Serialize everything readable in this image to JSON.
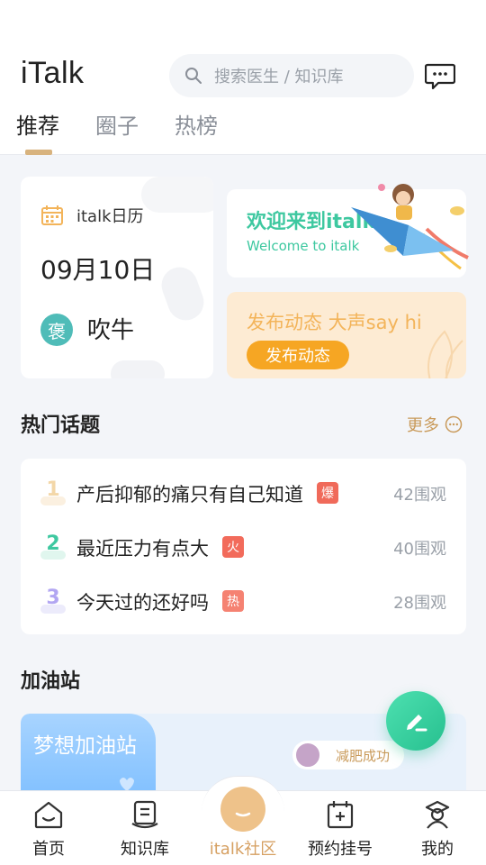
{
  "header": {
    "app_title": "iTalk",
    "search_placeholder": "搜索医生 / 知识库",
    "tabs": [
      {
        "label": "推荐",
        "active": true
      },
      {
        "label": "圈子",
        "active": false
      },
      {
        "label": "热榜",
        "active": false
      }
    ]
  },
  "calendar": {
    "title": "italk日历",
    "date": "09月10日",
    "badge": "褒",
    "note": "吹牛"
  },
  "welcome": {
    "title": "欢迎来到italk",
    "subtitle": "Welcome to italk"
  },
  "post": {
    "title": "发布动态 大声say hi",
    "button": "发布动态"
  },
  "hot_topics": {
    "title": "热门话题",
    "more": "更多",
    "items": [
      {
        "rank": "1",
        "text": "产后抑郁的痛只有自己知道",
        "tag": "爆",
        "tag_color": "#f06a5a",
        "count": "42围观",
        "rank_color": "#f3d7a8"
      },
      {
        "rank": "2",
        "text": "最近压力有点大",
        "tag": "火",
        "tag_color": "#f26b5b",
        "count": "40围观",
        "rank_color": "#3ec8a0"
      },
      {
        "rank": "3",
        "text": "今天过的还好吗",
        "tag": "热",
        "tag_color": "#f58272",
        "count": "28围观",
        "rank_color": "#b2a6f2"
      }
    ]
  },
  "boost": {
    "title": "加油站",
    "card_title": "梦想加油站",
    "chip_text": "减肥成功"
  },
  "nav": {
    "items": [
      {
        "label": "首页"
      },
      {
        "label": "知识库"
      },
      {
        "label": "italk社区",
        "active": true
      },
      {
        "label": "预约挂号"
      },
      {
        "label": "我的"
      }
    ]
  }
}
